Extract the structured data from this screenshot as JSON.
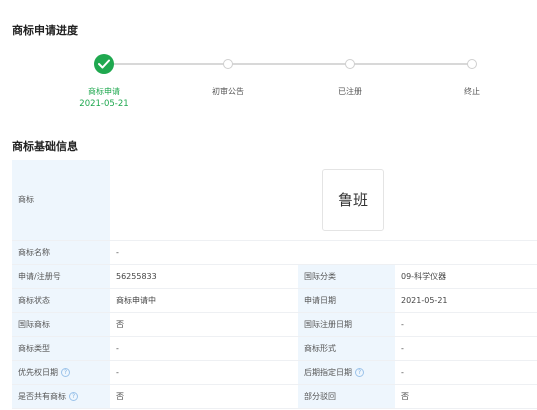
{
  "progress_section": {
    "title": "商标申请进度",
    "steps": [
      {
        "label": "商标申请",
        "date": "2021-05-21",
        "done": true
      },
      {
        "label": "初审公告",
        "date": "",
        "done": false
      },
      {
        "label": "已注册",
        "date": "",
        "done": false
      },
      {
        "label": "终止",
        "date": "",
        "done": false
      }
    ]
  },
  "info_section": {
    "title": "商标基础信息",
    "trademark_label": "商标",
    "trademark_image_text": "鲁班",
    "trademark_name_label": "商标名称",
    "trademark_name_value": "-",
    "rows": [
      {
        "l1": "申请/注册号",
        "v1": "56255833",
        "l2": "国际分类",
        "v2": "09-科学仪器"
      },
      {
        "l1": "商标状态",
        "v1": "商标申请中",
        "l2": "申请日期",
        "v2": "2021-05-21"
      },
      {
        "l1": "国际商标",
        "v1": "否",
        "l2": "国际注册日期",
        "v2": "-"
      },
      {
        "l1": "商标类型",
        "v1": "-",
        "l2": "商标形式",
        "v2": "-"
      },
      {
        "l1": "优先权日期",
        "v1": "-",
        "l2": "后期指定日期",
        "v2": "-"
      },
      {
        "l1": "是否共有商标",
        "v1": "否",
        "l2": "部分驳回",
        "v2": "否"
      }
    ],
    "help_glyph": "?"
  },
  "colors": {
    "success": "#1fa84f",
    "label_bg": "#eef6fd",
    "pending": "#cfcfcf"
  }
}
